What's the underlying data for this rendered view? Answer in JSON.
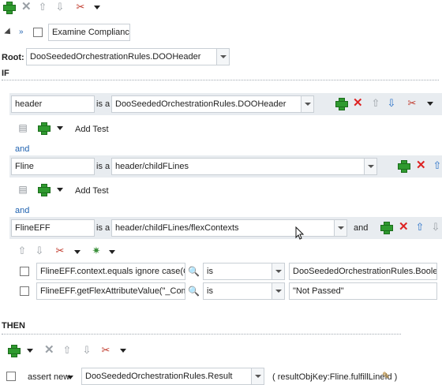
{
  "rule_header": {
    "rule_name": "Examine Compliance St"
  },
  "root": {
    "label": "Root:",
    "value": "DooSeededOrchestrationRules.DOOHeader"
  },
  "if_label": "IF",
  "then_label": "THEN",
  "and_label": "and",
  "add_test_label": "Add Test",
  "patterns": [
    {
      "alias": "header",
      "is_a": "is a",
      "fact": "DooSeededOrchestrationRules.DOOHeader"
    },
    {
      "alias": "Fline",
      "is_a": "is a",
      "fact": "header/childFLines"
    },
    {
      "alias": "FlineEFF",
      "is_a": "is a",
      "fact": "header/childFLines/flexContexts",
      "trailing": "and"
    }
  ],
  "tests": [
    {
      "left": "FlineEFF.context.equals ignore case(Compl",
      "op": "is",
      "right": "DooSeededOrchestrationRules.Boolean.TR"
    },
    {
      "left": "FlineEFF.getFlexAttributeValue(\"_Complianc",
      "op": "is",
      "right": "\"Not Passed\""
    }
  ],
  "action": {
    "type": "assert new",
    "target": "DooSeededOrchestrationRules.Result",
    "params": "( resultObjKey:Fline.fulfillLineId )"
  },
  "icons": {
    "add": "plus-icon",
    "delete": "delete-icon",
    "move_up": "arrow-up-icon",
    "move_down": "arrow-down-icon",
    "cut": "scissors-icon",
    "expression": "magnify-icon",
    "gear": "gear-icon",
    "copy": "copy-icon"
  },
  "colors": {
    "add_green": "#2f9a2f",
    "delete_red": "#dd2222",
    "link_blue": "#1f62b0",
    "band_bg": "#e8ecf0"
  }
}
